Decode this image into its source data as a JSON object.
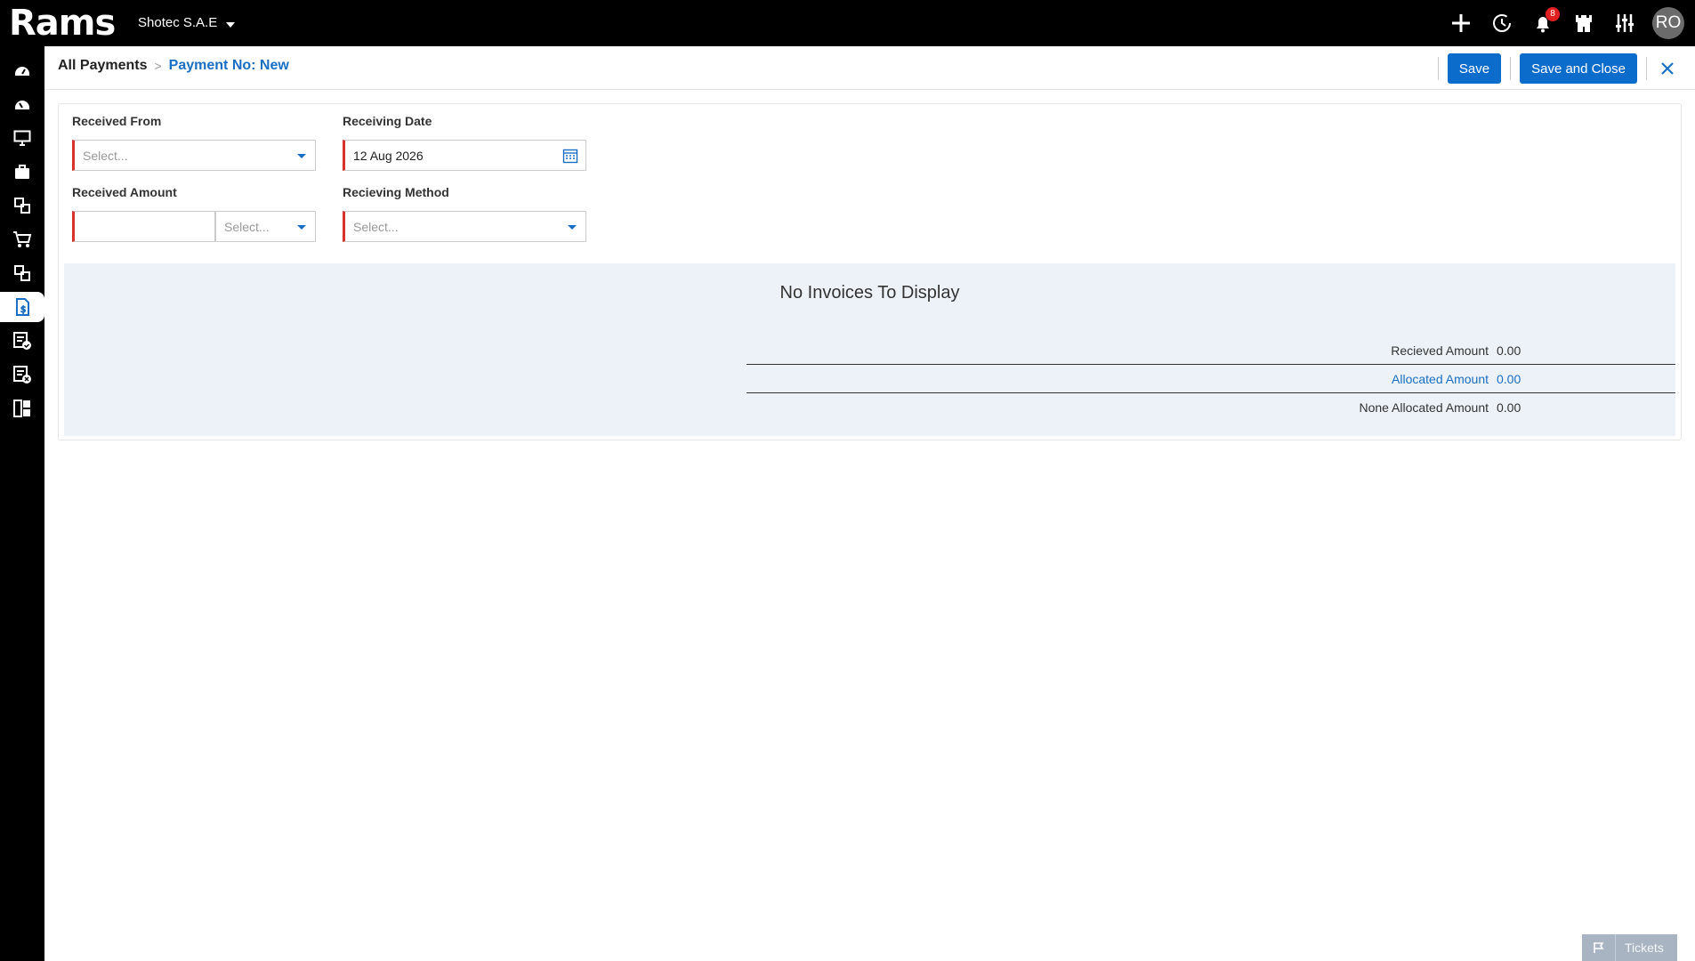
{
  "app": {
    "logo": "Rams",
    "company": "Shotec S.A.E"
  },
  "topbar": {
    "icons": [
      "plus-icon",
      "history-icon",
      "bell-icon",
      "castle-icon",
      "sliders-icon"
    ],
    "notifications_count": "8",
    "avatar_initials": "RO"
  },
  "sidebar": {
    "items": [
      {
        "icon": "dashboard-icon"
      },
      {
        "icon": "dashboard-alt-icon"
      },
      {
        "icon": "monitor-icon"
      },
      {
        "icon": "briefcase-icon"
      },
      {
        "icon": "modules-icon"
      },
      {
        "icon": "cart-icon"
      },
      {
        "icon": "modules-alt-icon"
      },
      {
        "icon": "payment-document-icon",
        "active": true
      },
      {
        "icon": "checked-list-icon"
      },
      {
        "icon": "cancel-list-icon"
      },
      {
        "icon": "reports-icon"
      }
    ]
  },
  "header": {
    "breadcrumb_root": "All Payments",
    "breadcrumb_separator": ">",
    "breadcrumb_current": "Payment No: New",
    "save_label": "Save",
    "save_close_label": "Save and Close"
  },
  "form": {
    "received_from": {
      "label": "Received From",
      "placeholder": "Select..."
    },
    "receiving_date": {
      "label": "Receiving Date",
      "value": "12 Aug 2026"
    },
    "received_amount": {
      "label": "Received Amount",
      "value": "",
      "currency_placeholder": "Select..."
    },
    "receiving_method": {
      "label": "Recieving Method",
      "placeholder": "Select..."
    }
  },
  "invoices": {
    "empty_message": "No Invoices To Display",
    "totals": [
      {
        "label": "Recieved Amount",
        "value": "0.00"
      },
      {
        "label": "Allocated Amount",
        "value": "0.00"
      },
      {
        "label": "None Allocated Amount",
        "value": "0.00"
      }
    ]
  },
  "footer": {
    "tickets_label": "Tickets"
  },
  "colors": {
    "accent": "#0b6ccc",
    "required": "#d9342b",
    "panel": "#edf2f8"
  }
}
